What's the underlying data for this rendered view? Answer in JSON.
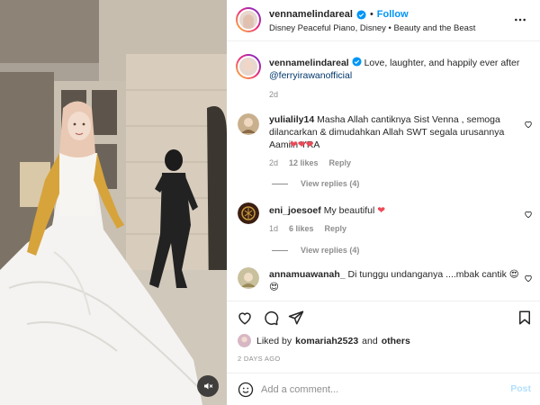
{
  "post": {
    "username": "vennamelindareal",
    "follow_label": "Follow",
    "separator": "•",
    "audio": "Disney Peaceful Piano, Disney • Beauty and the Beast",
    "caption_text": "Love, laughter, and happily ever after",
    "caption_mention": "@ferryirawanofficial",
    "caption_age": "2d"
  },
  "comments": [
    {
      "username": "yulialily14",
      "text": "Masha Allah cantiknya Sist Venna , semoga dilancarkan & dimudahkan Allah SWT segala urusannya Aamiin YRA",
      "hearts": "❤❤❤",
      "age": "2d",
      "likes": "12 likes",
      "reply": "Reply",
      "view_replies": "View replies (4)"
    },
    {
      "username": "eni_joesoef",
      "text": "My beautiful",
      "hearts": "❤",
      "age": "1d",
      "likes": "6 likes",
      "reply": "Reply",
      "view_replies": "View replies (4)"
    },
    {
      "username": "annamuawanah_",
      "text": "Di tunggu undanganya ....mbak cantik",
      "emoji": "😍",
      "emoji2": "😍"
    }
  ],
  "likes": {
    "prefix": "Liked by",
    "user": "komariah2523",
    "and": "and",
    "others": "others"
  },
  "timestamp": "2 DAYS AGO",
  "add_comment": {
    "placeholder": "Add a comment...",
    "post_label": "Post"
  },
  "colors": {
    "accent": "#0095f6",
    "heart": "#ed4956",
    "muted": "#8e8e8e",
    "mention": "#00376b"
  },
  "icons": [
    "verified-icon",
    "more-icon",
    "heart-icon",
    "comment-icon",
    "share-icon",
    "bookmark-icon",
    "emoji-icon",
    "mute-icon"
  ]
}
